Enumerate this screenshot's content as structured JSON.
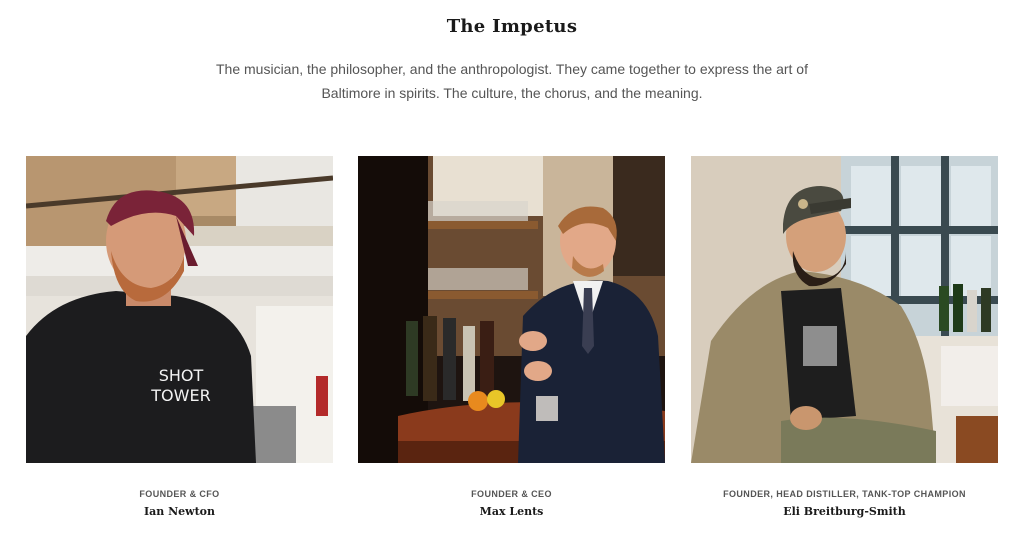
{
  "section": {
    "title": "The Impetus",
    "intro": "The musician, the philosopher, and the anthropologist. They came together to express the art of Baltimore in spirits. The culture, the chorus, and the meaning."
  },
  "team": [
    {
      "role": "FOUNDER & CFO",
      "name": "Ian Newton",
      "hoodie_text_line1": "SHOT",
      "hoodie_text_line2": "TOWER"
    },
    {
      "role": "FOUNDER & CEO",
      "name": "Max Lents"
    },
    {
      "role": "FOUNDER, HEAD DISTILLER, TANK-TOP CHAMPION",
      "name": "Eli Breitburg-Smith"
    }
  ],
  "colors": {
    "text": "#1a1a1a",
    "muted": "#555555",
    "background": "#ffffff"
  }
}
